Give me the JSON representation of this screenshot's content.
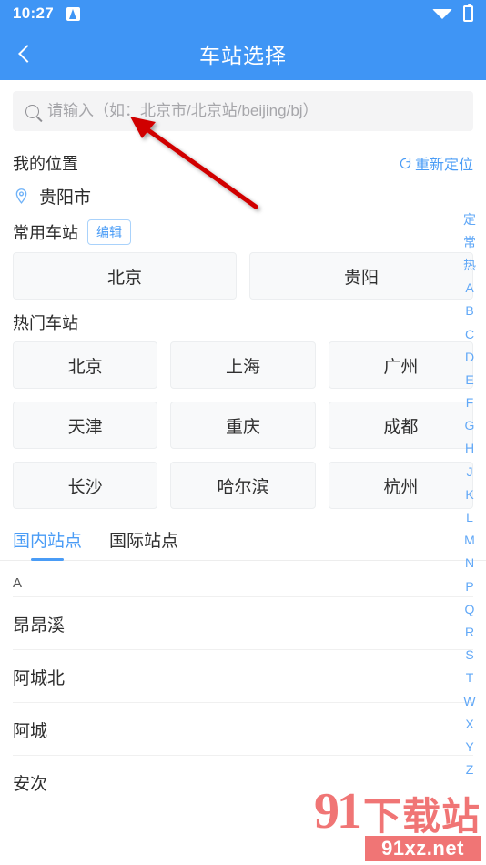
{
  "status_bar": {
    "time": "10:27",
    "app_badge_icon": "app-badge-icon",
    "wifi_icon": "wifi-icon",
    "battery_icon": "battery-charging-icon",
    "battery_bolt": "⚡"
  },
  "header": {
    "back_icon": "chevron-left-icon",
    "title": "车站选择"
  },
  "search": {
    "icon": "search-icon",
    "value": "",
    "placeholder": "请输入（如：北京市/北京站/beijing/bj）"
  },
  "my_location": {
    "title": "我的位置",
    "relocate_label": "重新定位",
    "relocate_icon": "refresh-icon",
    "pin_icon": "map-pin-icon",
    "city": "贵阳市"
  },
  "frequent_stations": {
    "title": "常用车站",
    "edit_label": "编辑",
    "items": [
      "北京",
      "贵阳"
    ]
  },
  "hot_stations": {
    "title": "热门车站",
    "items": [
      "北京",
      "上海",
      "广州",
      "天津",
      "重庆",
      "成都",
      "长沙",
      "哈尔滨",
      "杭州"
    ]
  },
  "tabs": [
    {
      "label": "国内站点",
      "active": true
    },
    {
      "label": "国际站点",
      "active": false
    }
  ],
  "station_list": {
    "section_letter": "A",
    "items": [
      "昂昂溪",
      "阿城北",
      "阿城",
      "安次"
    ]
  },
  "alpha_index": [
    "定",
    "常",
    "热",
    "A",
    "B",
    "C",
    "D",
    "E",
    "F",
    "G",
    "H",
    "J",
    "K",
    "L",
    "M",
    "N",
    "P",
    "Q",
    "R",
    "S",
    "T",
    "W",
    "X",
    "Y",
    "Z"
  ],
  "annotation": {
    "arrow_color": "#d00000",
    "arrow_description": "red-arrow-pointing-to-search-input"
  },
  "watermark": {
    "logo_number": "91",
    "logo_text": "下载站",
    "domain": "91xz.net"
  },
  "colors": {
    "brand_blue": "#3f95f5",
    "accent_blue": "#4a9cf6",
    "tile_bg": "#f8f9fa",
    "search_bg": "#f4f4f5",
    "annotation_red": "#d00000",
    "watermark_red": "#ef6a6a"
  }
}
